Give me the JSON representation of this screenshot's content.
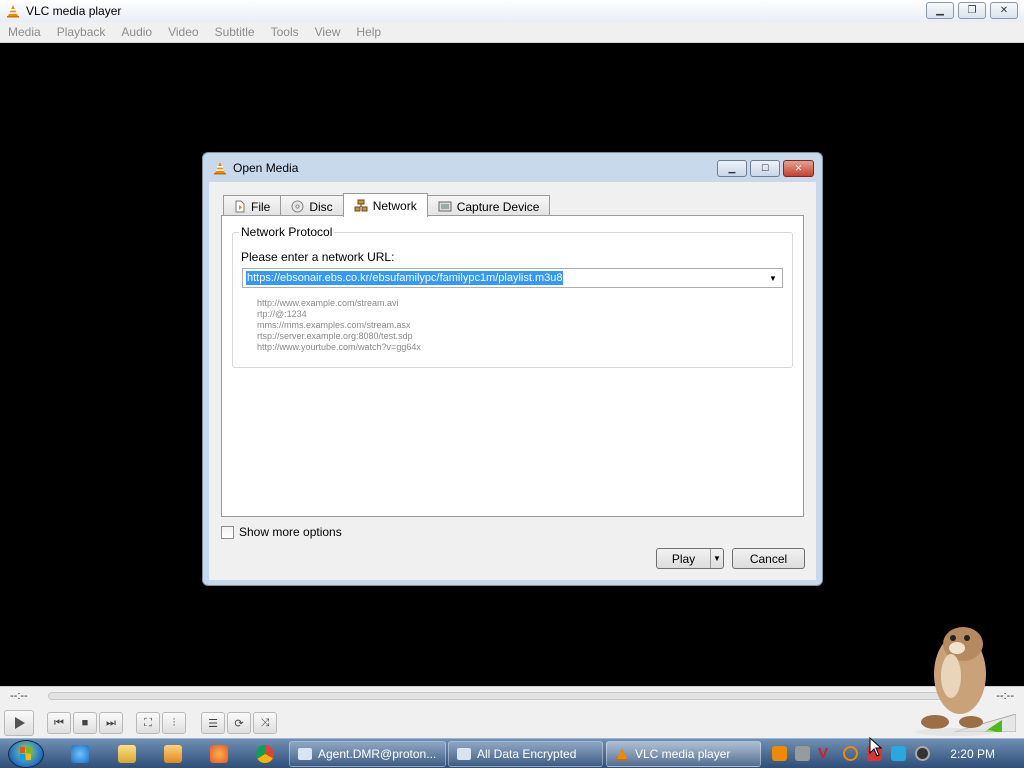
{
  "window": {
    "title": "VLC media player"
  },
  "menubar": {
    "items": [
      "Media",
      "Playback",
      "Audio",
      "Video",
      "Subtitle",
      "Tools",
      "View",
      "Help"
    ]
  },
  "controls": {
    "time_elapsed": "--:--",
    "time_remaining": "--:--",
    "seek_progress": 0,
    "buttons": [
      "play",
      "previous",
      "stop",
      "next",
      "fullscreen",
      "extended-settings",
      "playlist",
      "loop",
      "random"
    ]
  },
  "dialog": {
    "title": "Open Media",
    "tabs": [
      {
        "label": "File",
        "icon": "file-icon",
        "active": false
      },
      {
        "label": "Disc",
        "icon": "disc-icon",
        "active": false
      },
      {
        "label": "Network",
        "icon": "network-icon",
        "active": true
      },
      {
        "label": "Capture Device",
        "icon": "capture-device-icon",
        "active": false
      }
    ],
    "group_title": "Network Protocol",
    "url_label": "Please enter a network URL:",
    "url_value": "https://ebsonair.ebs.co.kr/ebsufamilypc/familypc1m/playlist.m3u8",
    "examples": [
      "http://www.example.com/stream.avi",
      "rtp://@:1234",
      "mms://mms.examples.com/stream.asx",
      "rtsp://server.example.org:8080/test.sdp",
      "http://www.yourtube.com/watch?v=gg64x"
    ],
    "show_more_options": "Show more options",
    "show_more_checked": false,
    "play_label": "Play",
    "cancel_label": "Cancel"
  },
  "taskbar": {
    "tasks": [
      {
        "label": "Agent.DMR@proton...",
        "active": false
      },
      {
        "label": "All Data Encrypted",
        "active": false
      },
      {
        "label": "VLC media player",
        "active": true
      }
    ],
    "clock": "2:20 PM"
  },
  "colors": {
    "vlc_orange": "#f08a00",
    "selection_blue": "#3399ff",
    "dialog_frame": "#c8d9ec",
    "taskbar": "#3a5a84"
  }
}
